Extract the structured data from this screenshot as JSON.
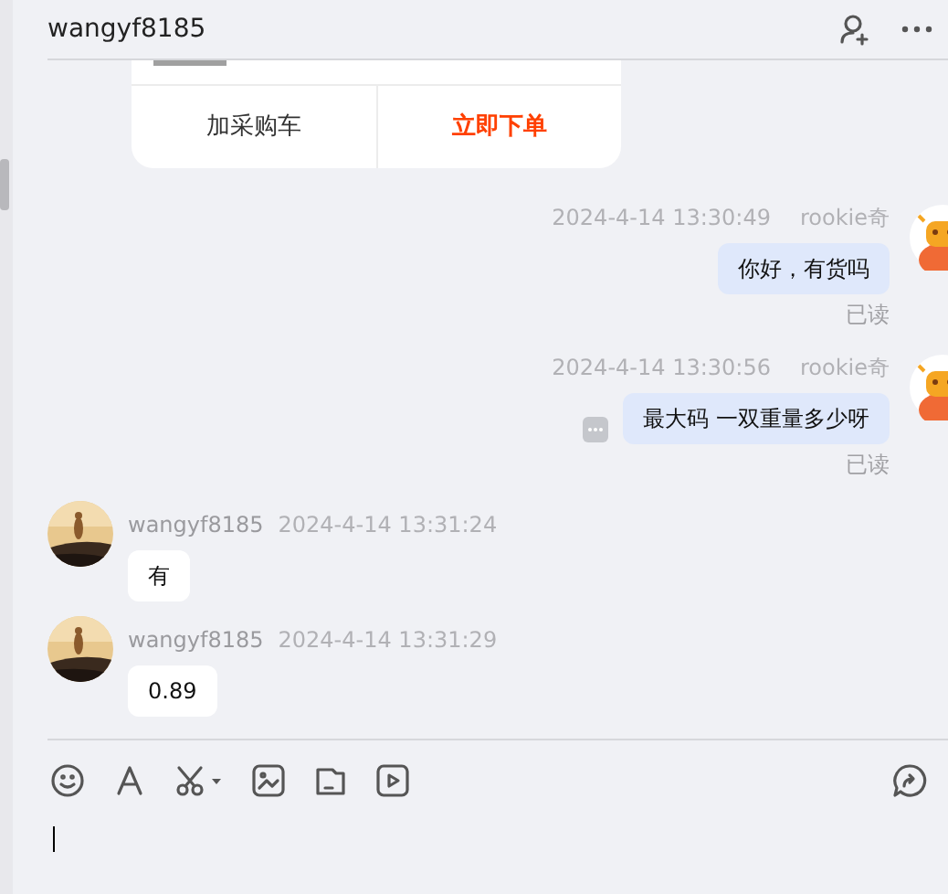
{
  "header": {
    "title": "wangyf8185"
  },
  "product_card": {
    "buttons": [
      {
        "label": "加采购车",
        "kind": "secondary"
      },
      {
        "label": "立即下单",
        "kind": "primary"
      }
    ]
  },
  "messages": [
    {
      "kind": "out",
      "sender": "rookie奇",
      "time": "2024-4-14 13:30:49",
      "text": "你好，有货吗",
      "status": "已读",
      "has_more": false
    },
    {
      "kind": "out",
      "sender": "rookie奇",
      "time": "2024-4-14 13:30:56",
      "text": "最大码  一双重量多少呀",
      "status": "已读",
      "has_more": true
    },
    {
      "kind": "in",
      "sender": "wangyf8185",
      "time": "2024-4-14 13:31:24",
      "text": "有"
    },
    {
      "kind": "in",
      "sender": "wangyf8185",
      "time": "2024-4-14 13:31:29",
      "text": "0.89"
    }
  ]
}
